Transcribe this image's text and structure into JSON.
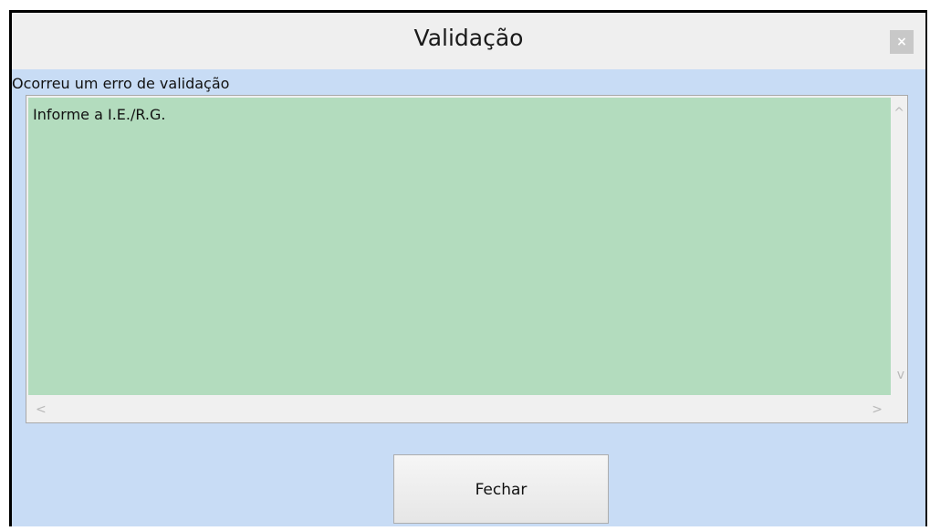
{
  "window": {
    "title": "Validação",
    "close_glyph": "×"
  },
  "error": {
    "label": "Ocorreu um erro de validação",
    "message": "Informe a I.E./R.G."
  },
  "scrollbars": {
    "up": "^",
    "down": "v",
    "left": "<",
    "right": ">"
  },
  "actions": {
    "close_label": "Fechar"
  },
  "colors": {
    "panel": "#c8dcf5",
    "message_background": "#b3dcbe",
    "titlebar": "#efefef"
  }
}
